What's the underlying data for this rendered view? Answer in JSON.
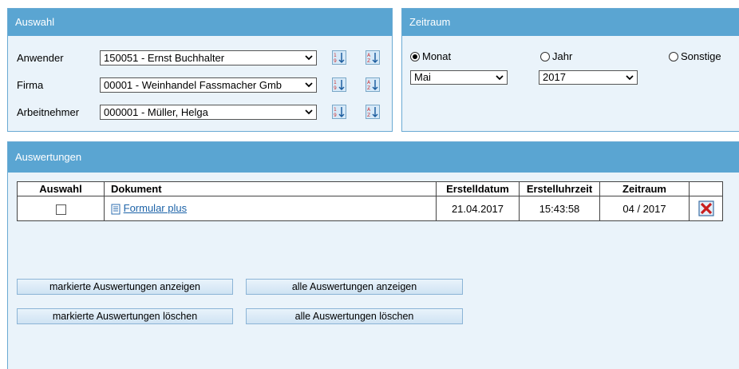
{
  "auswahl": {
    "title": "Auswahl",
    "rows": [
      {
        "label": "Anwender",
        "value": "150051 - Ernst Buchhalter"
      },
      {
        "label": "Firma",
        "value": "00001 - Weinhandel Fassmacher Gmb"
      },
      {
        "label": "Arbeitnehmer",
        "value": "000001 - Müller, Helga"
      }
    ]
  },
  "zeitraum": {
    "title": "Zeitraum",
    "radios": [
      {
        "label": "Monat",
        "checked": true
      },
      {
        "label": "Jahr",
        "checked": false
      },
      {
        "label": "Sonstige",
        "checked": false
      }
    ],
    "month_value": "Mai",
    "year_value": "2017"
  },
  "auswertungen": {
    "title": "Auswertungen",
    "columns": [
      "Auswahl",
      "Dokument",
      "Erstelldatum",
      "Erstelluhrzeit",
      "Zeitraum",
      ""
    ],
    "rows": [
      {
        "selected": false,
        "document": "Formular plus",
        "date": "21.04.2017",
        "time": "15:43:58",
        "period": "04 / 2017"
      }
    ],
    "buttons": {
      "show_marked": "markierte Auswertungen anzeigen",
      "show_all": "alle Auswertungen anzeigen",
      "delete_marked": "markierte Auswertungen löschen",
      "delete_all": "alle Auswertungen löschen"
    }
  },
  "colors": {
    "header": "#5aa5d2",
    "panel_bg": "#eaf3fa",
    "link": "#1d63a8",
    "delete": "#c81e1e"
  }
}
